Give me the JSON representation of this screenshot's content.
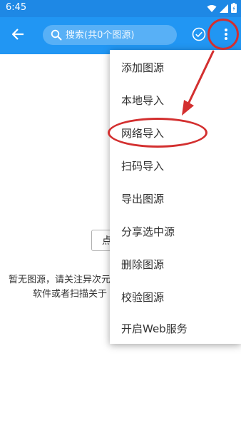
{
  "status_bar": {
    "time": "6:45",
    "icons": [
      "wifi-icon",
      "signal-icon",
      "battery-icon"
    ]
  },
  "app_bar": {
    "back_icon": "back-arrow-icon",
    "search": {
      "placeholder": "搜索(共0个图源)",
      "value": ""
    },
    "check_icon": "check-circle-icon",
    "more_icon": "more-vert-icon",
    "color": "#2196f3"
  },
  "background": {
    "import_button_label": "点",
    "empty_line1": "暂无图源，请关注异次元",
    "empty_line2": "软件或者扫描关于"
  },
  "menu": {
    "items": [
      {
        "label": "添加图源"
      },
      {
        "label": "本地导入"
      },
      {
        "label": "网络导入"
      },
      {
        "label": "扫码导入"
      },
      {
        "label": "导出图源"
      },
      {
        "label": "分享选中源"
      },
      {
        "label": "删除图源"
      },
      {
        "label": "校验图源"
      },
      {
        "label": "开启Web服务"
      }
    ]
  },
  "annotation": {
    "color": "#d32f2f"
  }
}
